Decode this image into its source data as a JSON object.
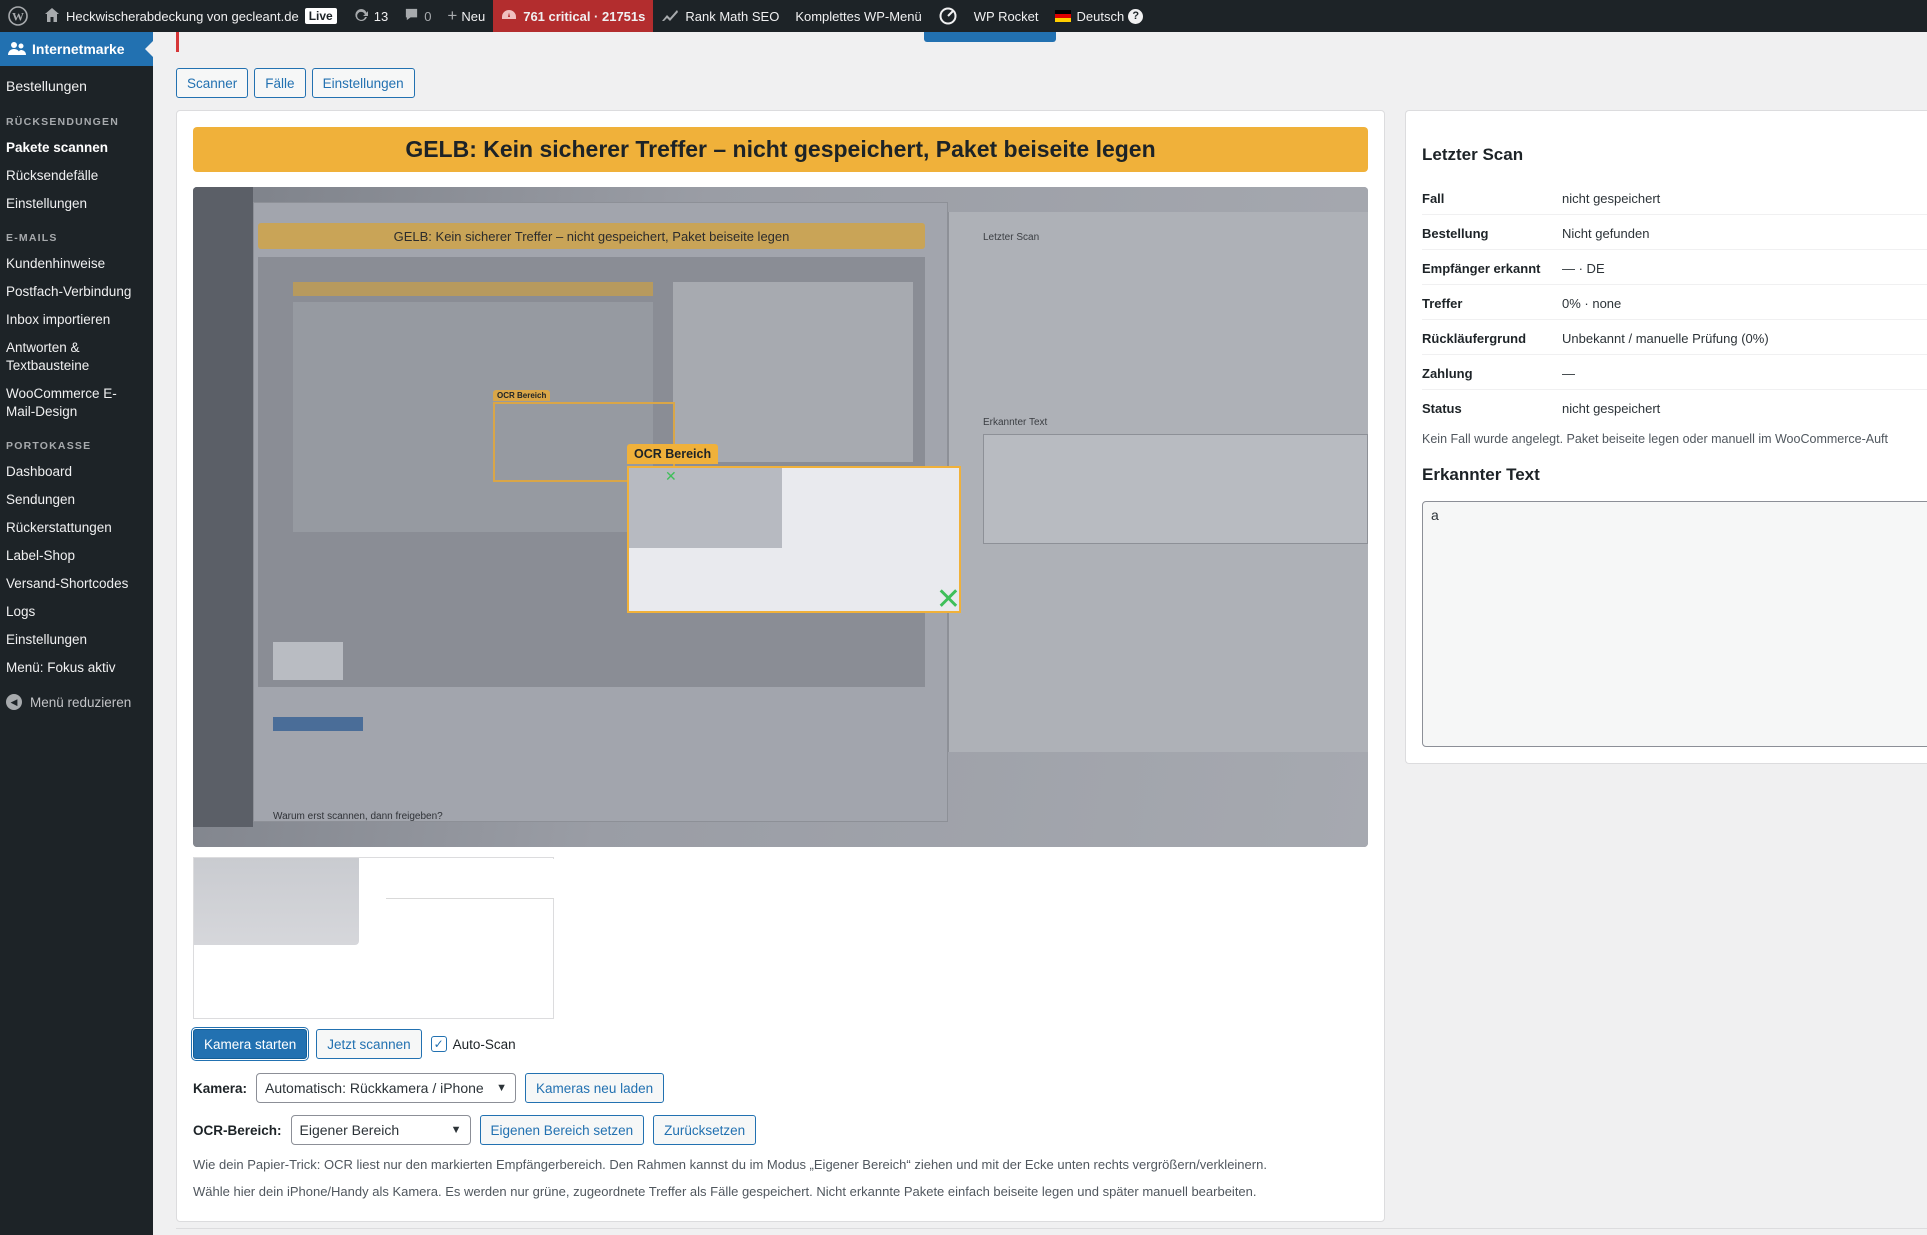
{
  "adminbar": {
    "site_name": "Heckwischerabdeckung von gecleant.de",
    "live_badge": "Live",
    "updates_count": "13",
    "comments_count": "0",
    "new_label": "Neu",
    "critical_label": "761 critical · 21751s",
    "rank_math": "Rank Math SEO",
    "full_menu": "Komplettes WP-Menü",
    "wp_rocket": "WP Rocket",
    "language": "Deutsch"
  },
  "sidebar": {
    "current": "Internetmarke",
    "top_items": [
      "Bestellungen"
    ],
    "sections": [
      {
        "heading": "RÜCKSENDUNGEN",
        "items": [
          "Pakete scannen",
          "Rücksendefälle",
          "Einstellungen"
        ]
      },
      {
        "heading": "E-MAILS",
        "items": [
          "Kundenhinweise",
          "Postfach-Verbindung",
          "Inbox importieren",
          "Antworten & Textbausteine",
          "WooCommerce E-Mail-Design"
        ]
      },
      {
        "heading": "PORTOKASSE",
        "items": [
          "Dashboard",
          "Sendungen",
          "Rückerstattungen",
          "Label-Shop",
          "Versand-Shortcodes",
          "Logs",
          "Einstellungen",
          "Menü: Fokus aktiv"
        ]
      }
    ],
    "active_item": "Pakete scannen",
    "collapse_label": "Menü reduzieren"
  },
  "tabs": [
    "Scanner",
    "Fälle",
    "Einstellungen"
  ],
  "scanner": {
    "status_banner": "GELB: Kein sicherer Treffer – nicht gespeichert, Paket beiseite legen",
    "ocr_label": "OCR Bereich",
    "start_camera": "Kamera starten",
    "scan_now": "Jetzt scannen",
    "auto_scan_label": "Auto-Scan",
    "auto_scan_checked": true,
    "camera_label": "Kamera:",
    "camera_value": "Automatisch: Rückkamera / iPhone",
    "reload_cameras": "Kameras neu laden",
    "ocr_area_label": "OCR-Bereich:",
    "ocr_area_value": "Eigener Bereich",
    "set_area": "Eigenen Bereich setzen",
    "reset": "Zurücksetzen",
    "help_1": "Wie dein Papier-Trick: OCR liest nur den markierten Empfängerbereich. Den Rahmen kannst du im Modus „Eigener Bereich“ ziehen und mit der Ecke unten rechts vergrößern/verkleinern.",
    "help_2": "Wähle hier dein iPhone/Handy als Kamera. Es werden nur grüne, zugeordnete Treffer als Fälle gespeichert. Nicht erkannte Pakete einfach beiseite legen und später manuell bearbeiten.",
    "feed_status_banner": "GELB: Kein sicherer Treffer – nicht gespeichert, Paket beiseite legen",
    "feed_last_scan": "Letzter Scan",
    "feed_recognized_text": "Erkannter Text",
    "feed_footer": "Warum erst scannen, dann freigeben?"
  },
  "last_scan": {
    "title": "Letzter Scan",
    "rows": [
      {
        "key": "Fall",
        "value": "nicht gespeichert"
      },
      {
        "key": "Bestellung",
        "value": "Nicht gefunden"
      },
      {
        "key": "Empfänger erkannt",
        "value": "— · DE"
      },
      {
        "key": "Treffer",
        "value": "0% · none"
      },
      {
        "key": "Rückläufergrund",
        "value": "Unbekannt / manuelle Prüfung (0%)"
      },
      {
        "key": "Zahlung",
        "value": "—"
      },
      {
        "key": "Status",
        "value": "nicht gespeichert"
      }
    ],
    "note": "Kein Fall wurde angelegt. Paket beiseite legen oder manuell im WooCommerce-Auft",
    "recognized_title": "Erkannter Text",
    "recognized_text": "a"
  },
  "colors": {
    "adminbar": "#1d2327",
    "accent": "#2271b1",
    "warning": "#f0b13a",
    "critical": "#b32d2e",
    "ok_green": "#3fbf5a"
  }
}
